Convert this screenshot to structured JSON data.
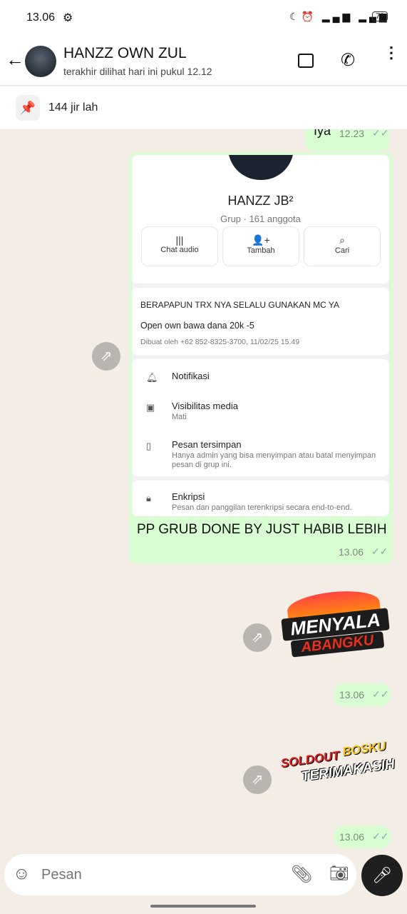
{
  "status_bar": {
    "time": "13.06",
    "battery": "79"
  },
  "header": {
    "contact_name": "HANZZ OWN ZUL",
    "last_seen": "terakhir dilihat hari ini pukul 12.12"
  },
  "pinned": {
    "text": "144 jir lah"
  },
  "messages": [
    {
      "text": "Iya",
      "time": "12.23"
    },
    {
      "screenshot": {
        "group_name": "HANZZ JB²",
        "group_meta": "Grup · 161 anggota",
        "actions": [
          "Chat audio",
          "Tambah",
          "Cari"
        ],
        "description_title": "BERAPAPUN TRX NYA SELALU GUNAKAN MC YA",
        "description_body": "Open own bawa dana 20k -5",
        "created_by": "Dibuat oleh +62 852-8325-3700, 11/02/25 15.49",
        "settings": [
          {
            "label": "Notifikasi",
            "sub": ""
          },
          {
            "label": "Visibilitas media",
            "sub": "Mati"
          },
          {
            "label": "Pesan tersimpan",
            "sub": "Hanya admin yang bisa menyimpan atau batal menyimpan pesan di grup ini."
          },
          {
            "label": "Enkripsi",
            "sub": "Pesan dan panggilan terenkripsi secara end-to-end."
          }
        ]
      },
      "caption": "PP GRUB DONE BY JUST HABIB LEBIH",
      "time": "13.06"
    },
    {
      "sticker_text": [
        "MENYALA",
        "ABANGKU"
      ],
      "time": "13.06"
    },
    {
      "sticker_text": [
        "SOLDOUT",
        "BOSKU",
        "TERIMAKASIH"
      ],
      "time": "13.06"
    }
  ],
  "input": {
    "placeholder": "Pesan"
  },
  "colors": {
    "bubble": "#d9fdd3",
    "background": "#f3ede6"
  }
}
